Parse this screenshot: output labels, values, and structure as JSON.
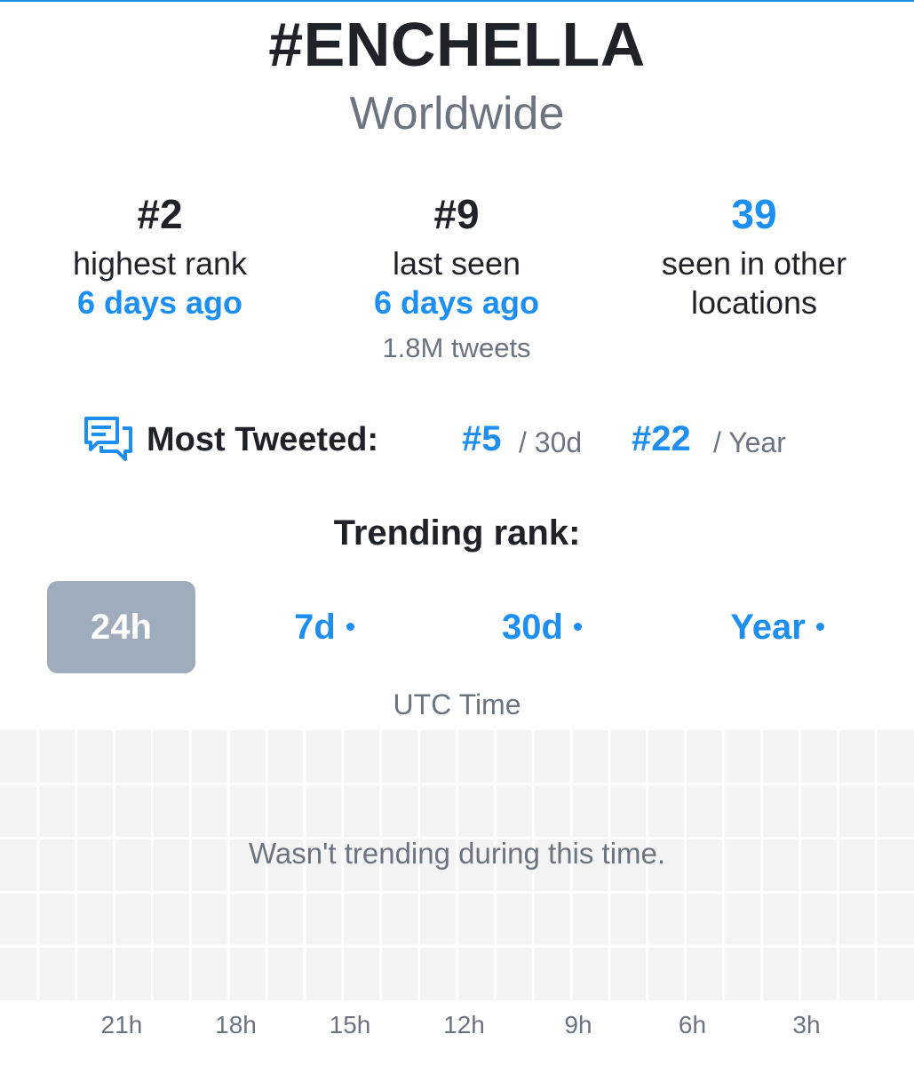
{
  "header": {
    "title": "#ENCHELLA",
    "location": "Worldwide"
  },
  "stats": {
    "highest": {
      "value": "#2",
      "label": "highest rank",
      "when": "6 days ago"
    },
    "last": {
      "value": "#9",
      "label": "last seen",
      "when": "6 days ago",
      "tweets": "1.8M tweets"
    },
    "other": {
      "value": "39",
      "label_line1": "seen in other",
      "label_line2": "locations"
    }
  },
  "most_tweeted": {
    "icon": "chat-bubbles-icon",
    "label": "Most Tweeted:",
    "rank_30d": "#5",
    "suffix_30d": "/ 30d",
    "rank_year": "#22",
    "suffix_year": "/ Year"
  },
  "trending": {
    "title": "Trending rank:",
    "tabs": [
      {
        "label": "24h",
        "active": true
      },
      {
        "label": "7d",
        "active": false
      },
      {
        "label": "30d",
        "active": false
      },
      {
        "label": "Year",
        "active": false
      }
    ],
    "axis_title": "UTC Time",
    "empty_message": "Wasn't trending during this time.",
    "x_ticks": [
      "21h",
      "18h",
      "15h",
      "12h",
      "9h",
      "6h",
      "3h"
    ]
  },
  "colors": {
    "accent": "#1d8ef2",
    "text": "#1f2329",
    "muted": "#6b7480",
    "active_tab": "#9eacbc",
    "grid_bg": "#f4f4f5"
  }
}
